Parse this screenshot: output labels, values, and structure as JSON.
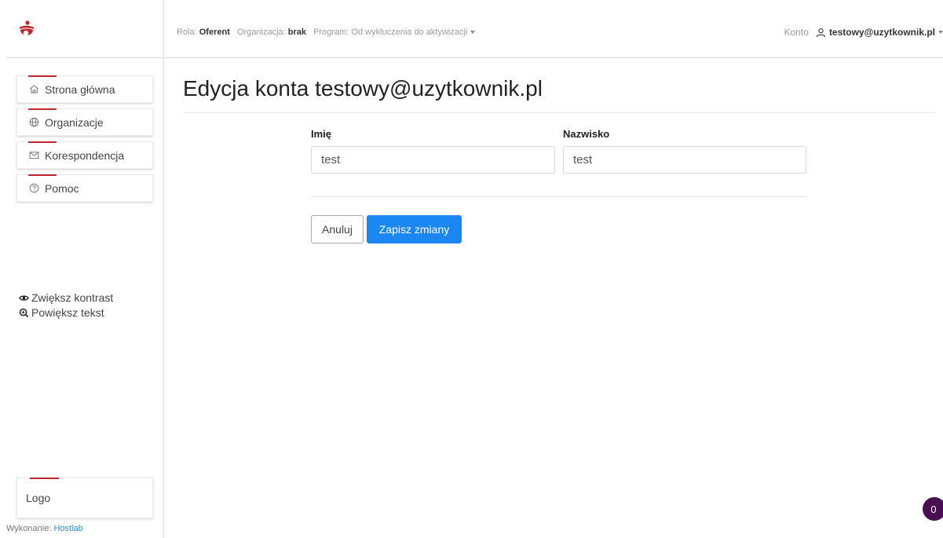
{
  "brand": {
    "logo_icon": "person-logo-icon",
    "accent_color": "#c0262d",
    "primary_color": "#1b87f3"
  },
  "sidebar": {
    "items": [
      {
        "label": "Strona główna",
        "icon": "home-icon"
      },
      {
        "label": "Organizacje",
        "icon": "globe-icon"
      },
      {
        "label": "Korespondencja",
        "icon": "envelope-icon"
      },
      {
        "label": "Pomoc",
        "icon": "help-circle-icon"
      }
    ],
    "accessibility": {
      "contrast_label": "Zwiększ kontrast",
      "zoom_label": "Powiększ tekst"
    },
    "footer_logo_label": "Logo",
    "credit_prefix": "Wykonanie:",
    "credit_link": "Hostlab"
  },
  "topbar": {
    "role_label": "Rola:",
    "role_value": "Oferent",
    "org_label": "Organizacja:",
    "org_value": "brak",
    "program_label": "Program:",
    "program_value": "Od wykluczenia do aktywizacji",
    "account_label": "Konto",
    "account_user": "testowy@uzytkownik.pl"
  },
  "main": {
    "title": "Edycja konta testowy@uzytkownik.pl",
    "form": {
      "first_name_label": "Imię",
      "first_name_value": "test",
      "last_name_label": "Nazwisko",
      "last_name_value": "test"
    },
    "cancel_label": "Anuluj",
    "save_label": "Zapisz zmiany"
  },
  "notification_count": "0"
}
